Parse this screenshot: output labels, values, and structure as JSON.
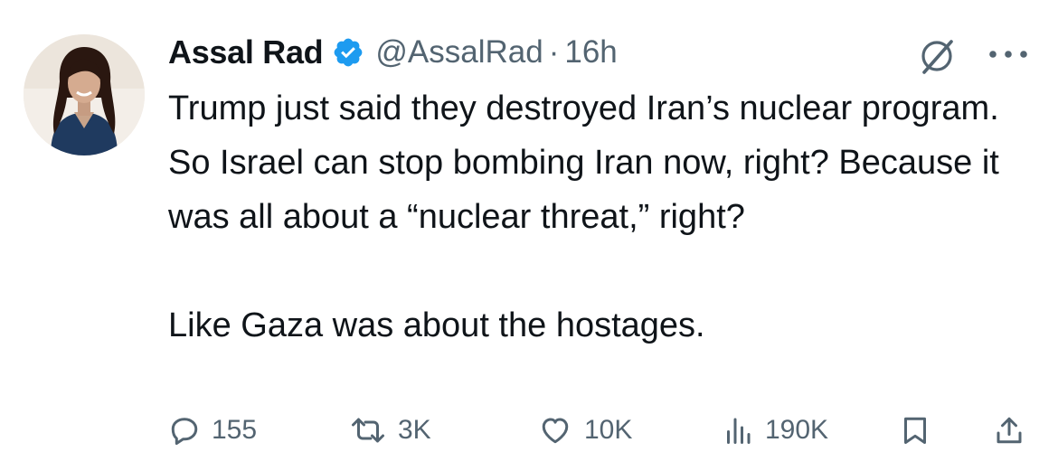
{
  "author": {
    "display_name": "Assal Rad",
    "handle": "@AssalRad",
    "separator": "·",
    "time": "16h",
    "verified": true
  },
  "tweet": {
    "paragraphs": [
      "Trump just said they destroyed Iran’s nuclear program. So Israel can stop bombing Iran now, right? Because it was all about a “nuclear threat,” right?",
      "Like Gaza was about the hostages."
    ]
  },
  "actions": {
    "replies": "155",
    "reposts": "3K",
    "likes": "10K",
    "views": "190K"
  },
  "icons": {
    "verified": "verified-badge-icon",
    "grok": "grok-icon",
    "more": "more-options-icon",
    "reply": "reply-icon",
    "repost": "repost-icon",
    "like": "heart-icon",
    "views": "analytics-icon",
    "bookmark": "bookmark-icon",
    "share": "share-icon"
  },
  "colors": {
    "text": "#0f1419",
    "secondary": "#536471",
    "verified_blue": "#1d9bf0"
  }
}
